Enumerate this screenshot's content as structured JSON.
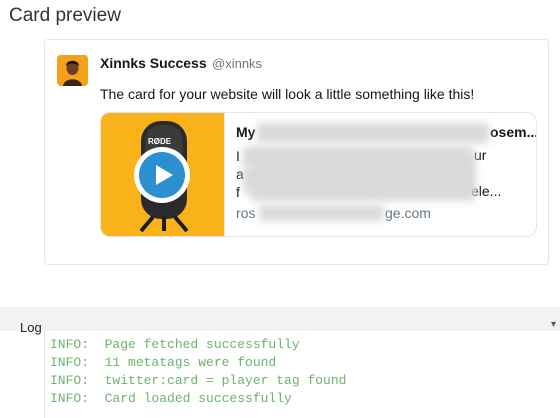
{
  "page": {
    "title": "Card preview"
  },
  "tweet": {
    "user_name": "Xinnks Success",
    "user_handle": "@xinnks",
    "text": "The card for your website will look a little something like this!"
  },
  "card": {
    "title_head": "My",
    "title_tail": "osem...",
    "description_lines": [
      "I",
      "a",
      "f"
    ],
    "description_tail": "ele...",
    "line2_tail": "ur",
    "domain_head": "ros",
    "domain_tail": "ge.com",
    "media_label": "RØDE"
  },
  "log": {
    "label": "Log",
    "lines": [
      "INFO:  Page fetched successfully",
      "INFO:  11 metatags were found",
      "INFO:  twitter:card = player tag found",
      "INFO:  Card loaded successfully"
    ]
  },
  "colors": {
    "media_background": "#f9ad14",
    "play_button": "#2b8fd1",
    "log_text": "#6fb26f"
  }
}
